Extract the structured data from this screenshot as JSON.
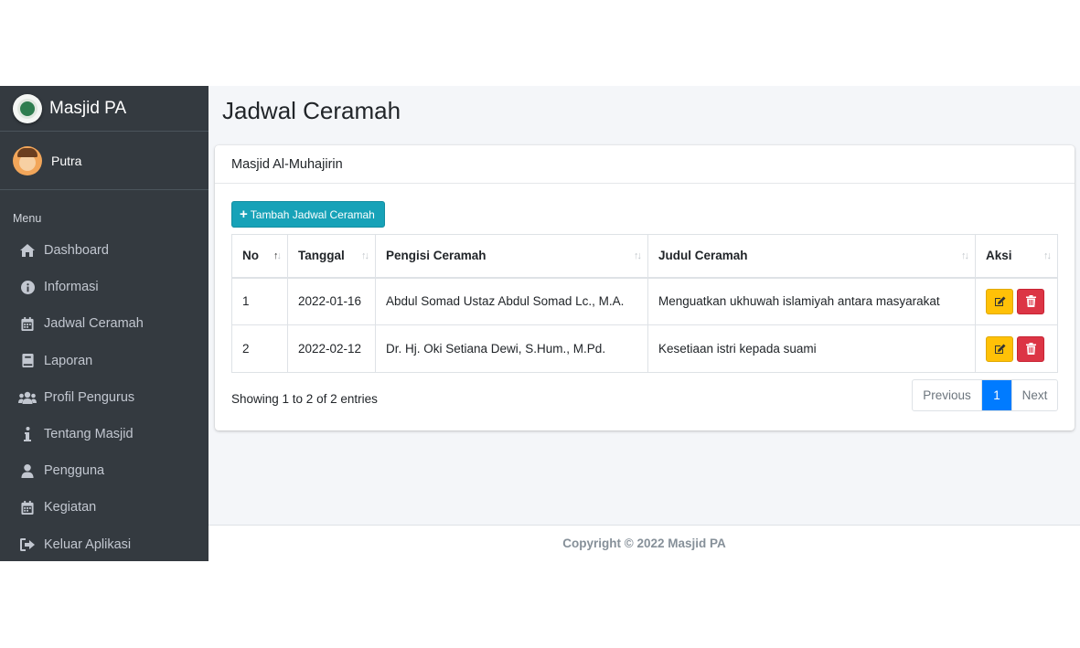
{
  "brand": {
    "name": "Masjid PA"
  },
  "user": {
    "name": "Putra"
  },
  "sidebar": {
    "menu_header": "Menu",
    "items": [
      {
        "label": "Dashboard",
        "icon": "home-icon"
      },
      {
        "label": "Informasi",
        "icon": "info-circle-icon"
      },
      {
        "label": "Jadwal Ceramah",
        "icon": "calendar-icon"
      },
      {
        "label": "Laporan",
        "icon": "book-icon"
      },
      {
        "label": "Profil Pengurus",
        "icon": "users-icon"
      },
      {
        "label": "Tentang Masjid",
        "icon": "info-icon"
      },
      {
        "label": "Pengguna",
        "icon": "user-icon"
      },
      {
        "label": "Kegiatan",
        "icon": "calendar-icon"
      },
      {
        "label": "Keluar Aplikasi",
        "icon": "sign-out-icon"
      }
    ]
  },
  "page": {
    "title": "Jadwal Ceramah"
  },
  "card": {
    "header": "Masjid Al-Muhajirin",
    "add_button": "Tambah Jadwal Ceramah"
  },
  "table": {
    "columns": [
      "No",
      "Tanggal",
      "Pengisi Ceramah",
      "Judul Ceramah",
      "Aksi"
    ],
    "rows": [
      {
        "no": "1",
        "tanggal": "2022-01-16",
        "pengisi": "Abdul Somad Ustaz Abdul Somad Lc., M.A.",
        "judul": "Menguatkan ukhuwah islamiyah antara masyarakat"
      },
      {
        "no": "2",
        "tanggal": "2022-02-12",
        "pengisi": "Dr. Hj. Oki Setiana Dewi, S.Hum., M.Pd.",
        "judul": "Kesetiaan istri kepada suami"
      }
    ]
  },
  "info": "Showing 1 to 2 of 2 entries",
  "pagination": {
    "previous": "Previous",
    "current": "1",
    "next": "Next"
  },
  "footer": "Copyright © 2022 Masjid PA",
  "colors": {
    "sidebar": "#343a40",
    "primary": "#007bff",
    "info": "#17a2b8",
    "warning": "#ffc107",
    "danger": "#dc3545"
  }
}
